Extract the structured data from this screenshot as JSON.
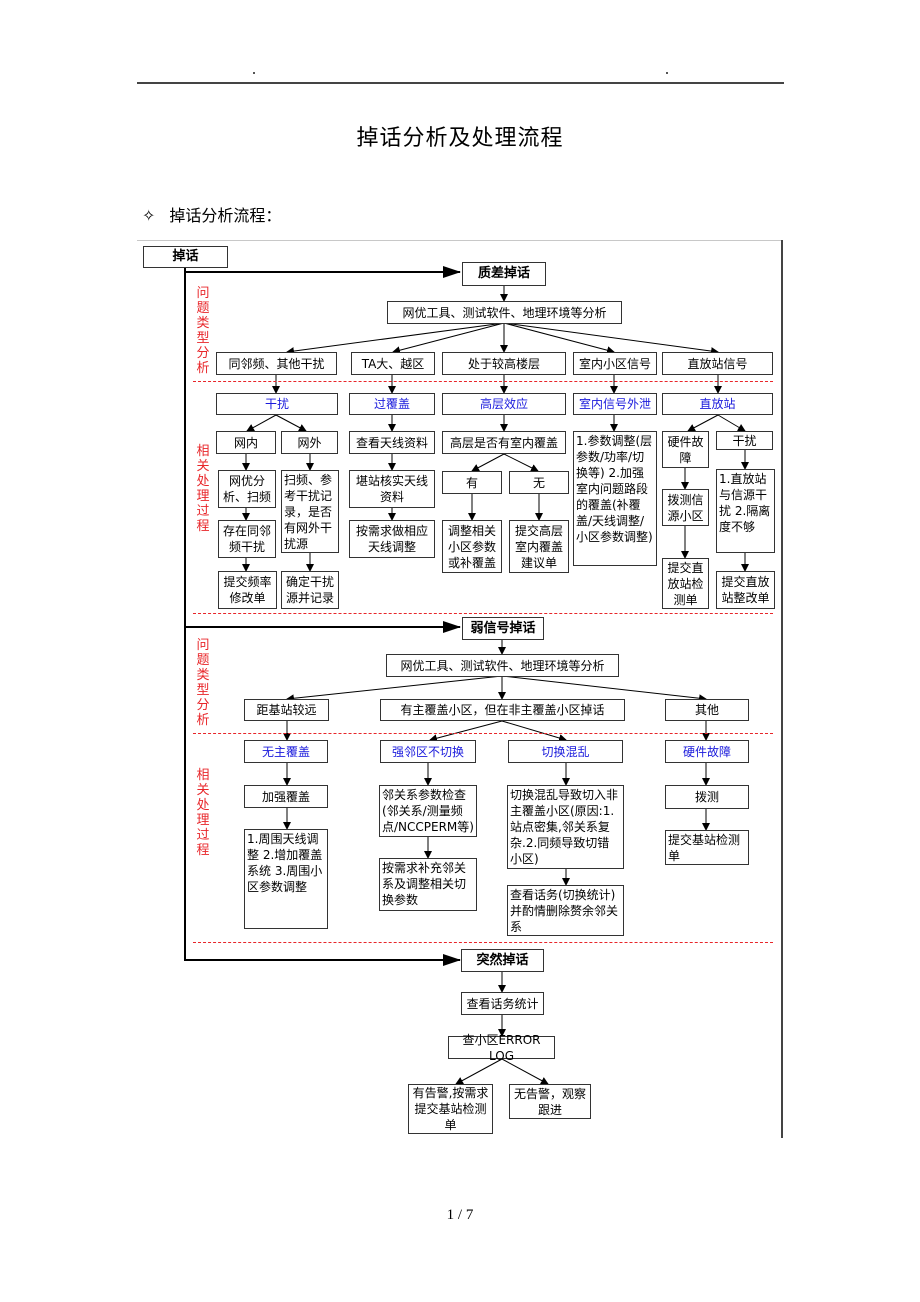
{
  "header": {
    "left_mark": ".",
    "right_mark": "."
  },
  "title": "掉话分析及处理流程",
  "section": {
    "bullet": "✧",
    "heading": "掉话分析流程："
  },
  "flow": {
    "root": "掉话",
    "side_labels": {
      "problem_type": "问题类型分析",
      "handling": "相关处理过程"
    },
    "quality": {
      "title": "质差掉话",
      "analysis": "网优工具、测试软件、地理环境等分析",
      "types": [
        "同邻频、其他干扰",
        "TA大、越区",
        "处于较高楼层",
        "室内小区信号",
        "直放站信号"
      ],
      "causes": [
        "干扰",
        "过覆盖",
        "高层效应",
        "室内信号外泄",
        "直放站"
      ],
      "interference": {
        "inner": "网内",
        "outer": "网外",
        "inner_step1": "网优分析、扫频",
        "inner_step2": "存在同邻频干扰",
        "inner_step3": "提交频率修改单",
        "outer_step1": "扫频、参考干扰记录，是否有网外干扰源",
        "outer_step2": "确定干扰源并记录"
      },
      "overshoot": {
        "step1": "查看天线资料",
        "step2": "堪站核实天线资料",
        "step3": "按需求做相应天线调整"
      },
      "highrise": {
        "question": "高层是否有室内覆盖",
        "yes": "有",
        "no": "无",
        "yes_action": "调整相关小区参数或补覆盖",
        "no_action": "提交高层室内覆盖建议单"
      },
      "indoor_leak": {
        "action": "1.参数调整(层参数/功率/切换等) 2.加强室内问题路段的覆盖(补覆盖/天线调整/小区参数调整)"
      },
      "repeater": {
        "hw_fault": "硬件故障",
        "hw_step1": "拨测信源小区",
        "hw_step2": "提交直放站检测单",
        "interference": "干扰",
        "int_step1": "1.直放站与信源干扰 2.隔离度不够",
        "int_step2": "提交直放站整改单"
      }
    },
    "weak": {
      "title": "弱信号掉话",
      "analysis": "网优工具、测试软件、地理环境等分析",
      "types": [
        "距基站较远",
        "有主覆盖小区，但在非主覆盖小区掉话",
        "其他"
      ],
      "causes": [
        "无主覆盖",
        "强邻区不切换",
        "切换混乱",
        "硬件故障"
      ],
      "no_main": {
        "step1": "加强覆盖",
        "step2": "1.周围天线调整 2.增加覆盖系统 3.周围小区参数调整"
      },
      "strong_nb": {
        "step1": "邻关系参数检查(邻关系/测量频点/NCCPERM等)",
        "step2": "按需求补充邻关系及调整相关切换参数"
      },
      "ho_chaos": {
        "step1": "切换混乱导致切入非主覆盖小区(原因:1.站点密集,邻关系复杂.2.同频导致切错小区)",
        "step2": "查看话务(切换统计)并酌情删除赘余邻关系"
      },
      "hw": {
        "step1": "拨测",
        "step2": "提交基站检测单"
      }
    },
    "sudden": {
      "title": "突然掉话",
      "step1": "查看话务统计",
      "step2": "查小区ERROR LOG",
      "alarm": "有告警,按需求提交基站检测单",
      "no_alarm": "无告警，观察跟进"
    }
  },
  "footer": {
    "page": "1 / 7"
  }
}
